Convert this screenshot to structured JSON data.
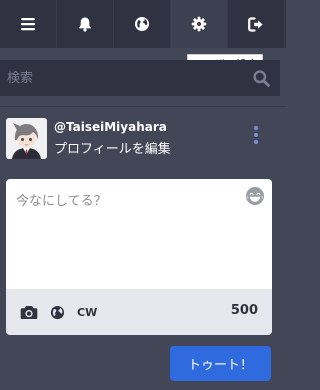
{
  "nav": {
    "items": [
      {
        "icon": "menu-icon"
      },
      {
        "icon": "bell-icon"
      },
      {
        "icon": "globe-icon"
      },
      {
        "icon": "gear-icon",
        "active": true
      },
      {
        "icon": "logout-icon"
      }
    ],
    "tooltip": "ユーザー設定"
  },
  "search": {
    "placeholder": "検索",
    "icon": "search-icon"
  },
  "profile": {
    "handle": "@TaiseiMiyahara",
    "edit_label": "プロフィールを編集"
  },
  "compose": {
    "placeholder": "今なにしてる？",
    "cw_label": "CW",
    "char_count": "500",
    "toot_label": "トゥート！"
  },
  "colors": {
    "background": "#434657",
    "nav": "#303241",
    "accent": "#2f6bdf",
    "dots": "#7c8de0"
  }
}
